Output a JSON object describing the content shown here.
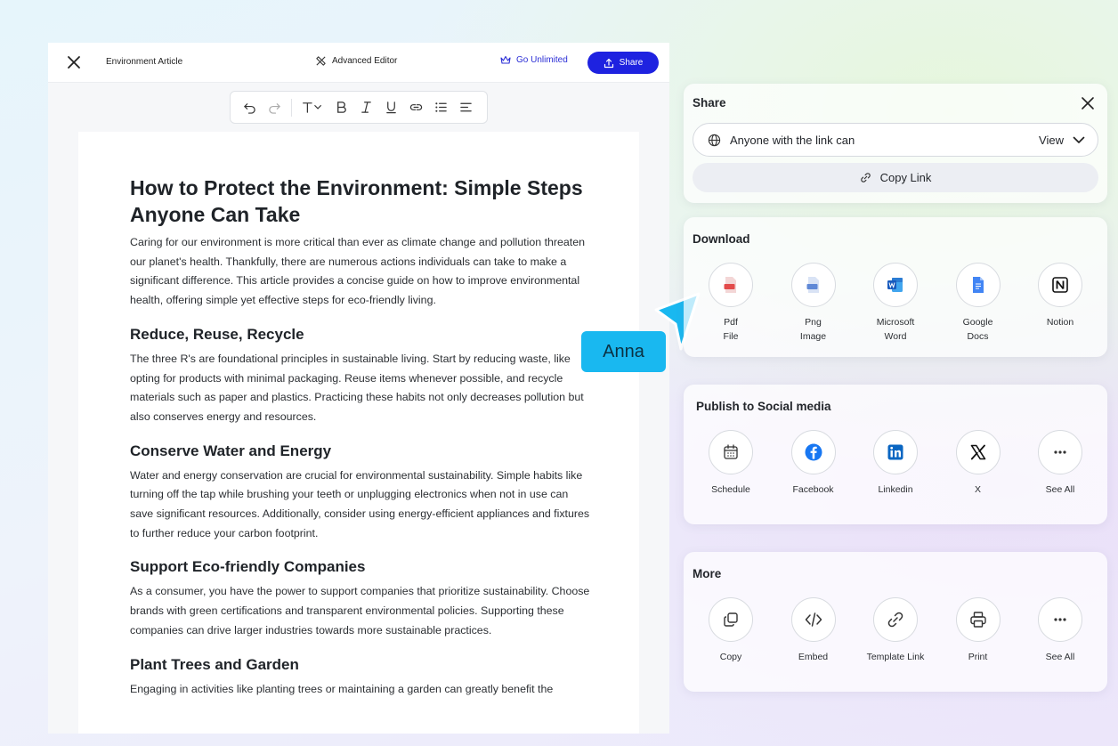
{
  "editor": {
    "doc_title": "Environment Article",
    "advanced_editor": "Advanced Editor",
    "go_unlimited": "Go Unlimited",
    "share_label": "Share"
  },
  "article": {
    "title": "How to Protect the Environment: Simple Steps Anyone Can Take",
    "intro": "Caring for our environment is more critical than ever as climate change and pollution threaten our planet's health. Thankfully, there are numerous actions individuals can take to make a significant difference. This article provides a concise guide on how to improve environmental health, offering simple yet effective steps for eco-friendly living.",
    "sections": [
      {
        "heading": "Reduce, Reuse, Recycle",
        "body": "The three R's are foundational principles in sustainable living. Start by reducing waste, like opting for products with minimal packaging. Reuse items whenever possible, and recycle materials such as paper and plastics. Practicing these habits not only decreases pollution but also conserves energy and resources."
      },
      {
        "heading": "Conserve Water and Energy",
        "body": "Water and energy conservation are crucial for environmental sustainability. Simple habits like turning off the tap while brushing your teeth or unplugging electronics when not in use can save significant resources. Additionally, consider using energy-efficient appliances and fixtures to further reduce your carbon footprint."
      },
      {
        "heading": "Support Eco-friendly Companies",
        "body": "As a consumer, you have the power to support companies that prioritize sustainability. Choose brands with green certifications and transparent environmental policies. Supporting these companies can drive larger industries towards more sustainable practices."
      },
      {
        "heading": "Plant Trees and Garden",
        "body": "Engaging in activities like planting trees or maintaining a garden can greatly benefit the"
      }
    ]
  },
  "collaborator": {
    "name": "Anna",
    "color": "#19b8f0"
  },
  "share_panel": {
    "title": "Share",
    "link_access": "Anyone with the link can",
    "permission": "View",
    "copy_link": "Copy Link"
  },
  "download": {
    "title": "Download",
    "items": [
      {
        "line1": "Pdf",
        "line2": "File",
        "icon": "pdf-file-icon"
      },
      {
        "line1": "Png",
        "line2": "Image",
        "icon": "png-image-icon"
      },
      {
        "line1": "Microsoft",
        "line2": "Word",
        "icon": "word-icon"
      },
      {
        "line1": "Google",
        "line2": "Docs",
        "icon": "google-docs-icon"
      },
      {
        "line1": "Notion",
        "line2": "",
        "icon": "notion-icon"
      }
    ]
  },
  "social": {
    "title": "Publish to Social media",
    "items": [
      {
        "label": "Schedule",
        "icon": "calendar-icon"
      },
      {
        "label": "Facebook",
        "icon": "facebook-icon"
      },
      {
        "label": "Linkedin",
        "icon": "linkedin-icon"
      },
      {
        "label": "X",
        "icon": "x-icon"
      },
      {
        "label": "See All",
        "icon": "more-dots-icon"
      }
    ]
  },
  "more": {
    "title": "More",
    "items": [
      {
        "label": "Copy",
        "icon": "copy-icon"
      },
      {
        "label": "Embed",
        "icon": "code-icon"
      },
      {
        "label": "Template Link",
        "icon": "link-icon"
      },
      {
        "label": "Print",
        "icon": "printer-icon"
      },
      {
        "label": "See All",
        "icon": "more-dots-icon"
      }
    ]
  },
  "colors": {
    "accent": "#1e22e0",
    "brand_link": "#2b2ed6",
    "facebook": "#1877f2",
    "linkedin": "#0a66c2"
  }
}
